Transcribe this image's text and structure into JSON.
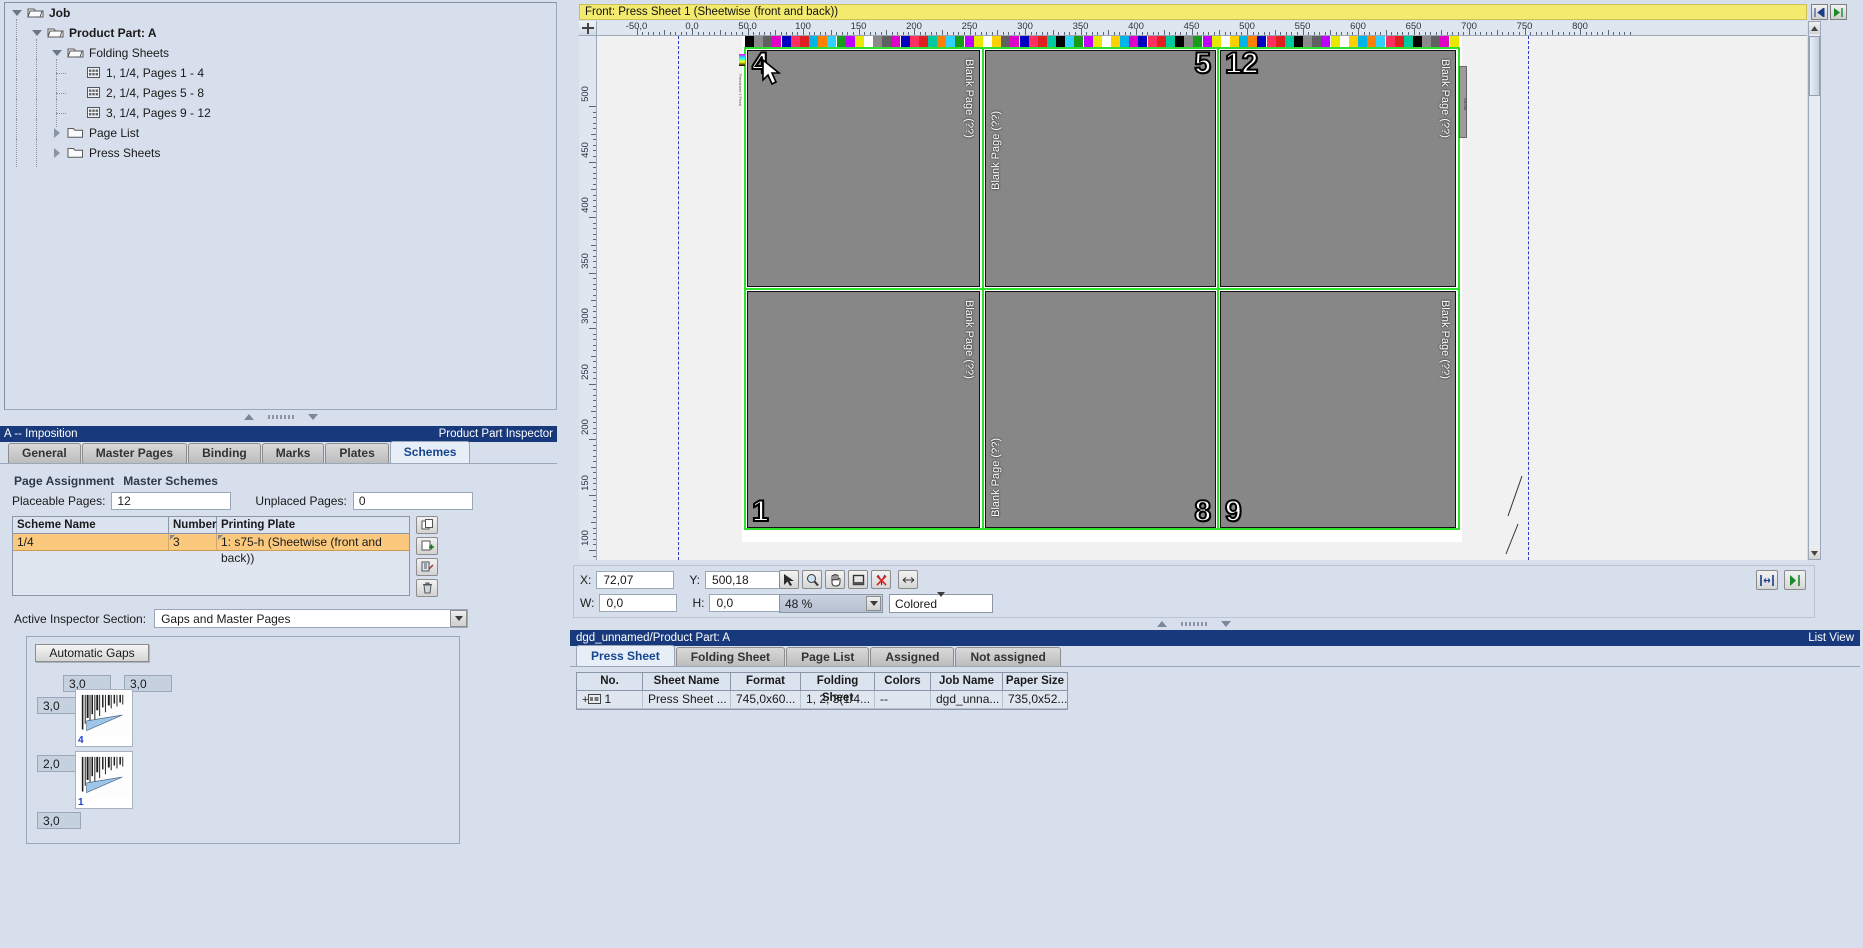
{
  "tree": {
    "items": [
      {
        "label": "Job",
        "depth": 0,
        "bold": true,
        "icon": "open-folder-icon",
        "toggle": "expanded"
      },
      {
        "label": "Product Part: A",
        "depth": 1,
        "bold": true,
        "icon": "open-folder-icon",
        "toggle": "expanded"
      },
      {
        "label": "Folding Sheets",
        "depth": 2,
        "bold": false,
        "icon": "open-folder-icon",
        "toggle": "expanded"
      },
      {
        "label": "1, 1/4, Pages 1 - 4",
        "depth": 3,
        "bold": false,
        "icon": "folding-sheet-icon",
        "toggle": "leaf"
      },
      {
        "label": "2, 1/4, Pages 5 - 8",
        "depth": 3,
        "bold": false,
        "icon": "folding-sheet-icon",
        "toggle": "leaf"
      },
      {
        "label": "3, 1/4, Pages 9 - 12",
        "depth": 3,
        "bold": false,
        "icon": "folding-sheet-icon",
        "toggle": "leaf"
      },
      {
        "label": "Page List",
        "depth": 2,
        "bold": false,
        "icon": "closed-folder-icon",
        "toggle": "collapsed"
      },
      {
        "label": "Press Sheets",
        "depth": 2,
        "bold": false,
        "icon": "closed-folder-icon",
        "toggle": "collapsed"
      }
    ]
  },
  "inspector": {
    "title_left": "A -- Imposition",
    "title_right": "Product Part Inspector",
    "tabs": [
      {
        "label": "General",
        "active": false
      },
      {
        "label": "Master Pages",
        "active": false
      },
      {
        "label": "Binding",
        "active": false
      },
      {
        "label": "Marks",
        "active": false
      },
      {
        "label": "Plates",
        "active": false
      },
      {
        "label": "Schemes",
        "active": true
      }
    ],
    "group_legend_a": "Page Assignment",
    "group_legend_b": "Master Schemes",
    "placeable_pages_label": "Placeable Pages:",
    "placeable_pages_value": "12",
    "unplaced_pages_label": "Unplaced Pages:",
    "unplaced_pages_value": "0",
    "schemes_table": {
      "headers": [
        "Scheme Name",
        "Number",
        "Printing Plate"
      ],
      "rows": [
        {
          "scheme_name": "1/4",
          "number": "3",
          "printing_plate": "1: s75-h (Sheetwise (front and back))"
        }
      ]
    },
    "scheme_buttons": [
      "duplicate-scheme-button",
      "add-scheme-button",
      "edit-scheme-button",
      "delete-scheme-button"
    ],
    "active_section_label": "Active Inspector Section:",
    "active_section_value": "Gaps and Master Pages",
    "gaps": {
      "automatic_gaps_label": "Automatic Gaps",
      "top_gaps": [
        "3,0",
        "3,0"
      ],
      "left_gaps": [
        "3,0",
        "2,0",
        "3,0"
      ],
      "thumbnails": [
        {
          "number": "4"
        },
        {
          "number": "1"
        }
      ]
    }
  },
  "canvas": {
    "title": "Front:  Press Sheet 1 (Sheetwise (front and back))",
    "nav_first_icon": "go-first-icon",
    "nav_next_icon": "go-next-icon",
    "ruler_h_labels": [
      "-50,0",
      "0,0",
      "50,0",
      "100",
      "150",
      "200",
      "250",
      "300",
      "350",
      "400",
      "450",
      "500",
      "550",
      "600",
      "650",
      "700",
      "750",
      "800"
    ],
    "ruler_v_labels": [
      "500",
      "450",
      "400",
      "350",
      "300",
      "250",
      "200",
      "150",
      "100"
    ],
    "pages": [
      {
        "number": "4",
        "num_pos": "top-left",
        "label": "Blank Page (??)",
        "label_pos": "right"
      },
      {
        "number": "5",
        "num_pos": "top-right",
        "label": "Blank Page (??)",
        "label_pos": "left"
      },
      {
        "number": "12",
        "num_pos": "top-left",
        "label": "Blank Page (??)",
        "label_pos": "right"
      },
      {
        "number": "1",
        "num_pos": "bottom-left",
        "label": "Blank Page (??)",
        "label_pos": "right"
      },
      {
        "number": "8",
        "num_pos": "bottom-right",
        "label": "Blank Page (??)",
        "label_pos": "left"
      },
      {
        "number": "9",
        "num_pos": "bottom-left",
        "label": "Blank Page (??)",
        "label_pos": "right"
      }
    ],
    "blank_page_text": "Blank Page (??)"
  },
  "coordbar": {
    "x_label": "X:",
    "x_value": "72,07",
    "y_label": "Y:",
    "y_value": "500,18",
    "w_label": "W:",
    "w_value": "0,0",
    "h_label": "H:",
    "h_value": "0,0",
    "zoom_value": "48 %",
    "color_mode": "Colored",
    "tools": [
      "select-arrow-tool",
      "zoom-tool",
      "pan-hand-tool",
      "crop-frame-tool",
      "delete-marks-tool",
      "measure-tool"
    ],
    "right_tools": [
      "fit-page-button",
      "next-sheet-button"
    ]
  },
  "listview": {
    "title": "dgd_unnamed/Product Part: A",
    "title_right": "List View",
    "tabs": [
      {
        "label": "Press Sheet",
        "active": true
      },
      {
        "label": "Folding Sheet",
        "active": false
      },
      {
        "label": "Page List",
        "active": false
      },
      {
        "label": "Assigned",
        "active": false
      },
      {
        "label": "Not assigned",
        "active": false
      }
    ],
    "table": {
      "headers": [
        "No.",
        "Sheet Name",
        "Format",
        "Folding Sheet",
        "Colors",
        "Job Name",
        "Paper Size"
      ],
      "rows": [
        {
          "no": "1",
          "sheet_name": "Press Sheet ...",
          "format": "745,0x60...",
          "folding_sheet": "1, 2, 3(1/4...",
          "colors": "--",
          "job_name": "dgd_unna...",
          "paper_size": "735,0x52..."
        }
      ]
    }
  },
  "colors": {
    "title_bar": "#183a7c",
    "accent_tab": "#16468e",
    "selection_row": "#fbc97e",
    "canvas_title": "#f3ea6e",
    "page_fill": "#878787",
    "trim_green": "#2ee02e"
  }
}
